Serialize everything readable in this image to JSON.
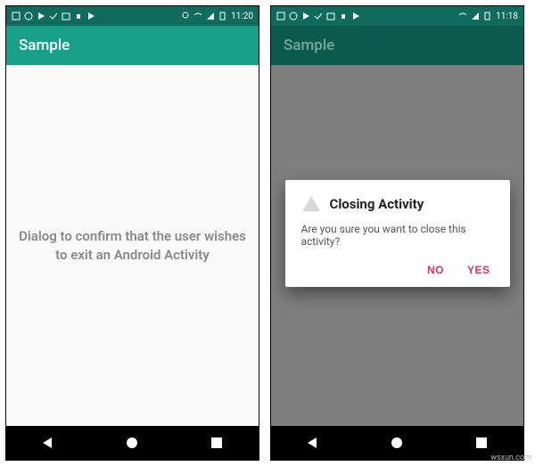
{
  "statusbar": {
    "time": "11:20",
    "time2": "11:18"
  },
  "appbar": {
    "title": "Sample"
  },
  "body": {
    "text": "Dialog to confirm that the user wishes to exit an Android Activity"
  },
  "dialog": {
    "title": "Closing Activity",
    "message": "Are you sure you want to close this activity?",
    "no": "NO",
    "yes": "YES"
  },
  "watermark": "wsxun.com"
}
